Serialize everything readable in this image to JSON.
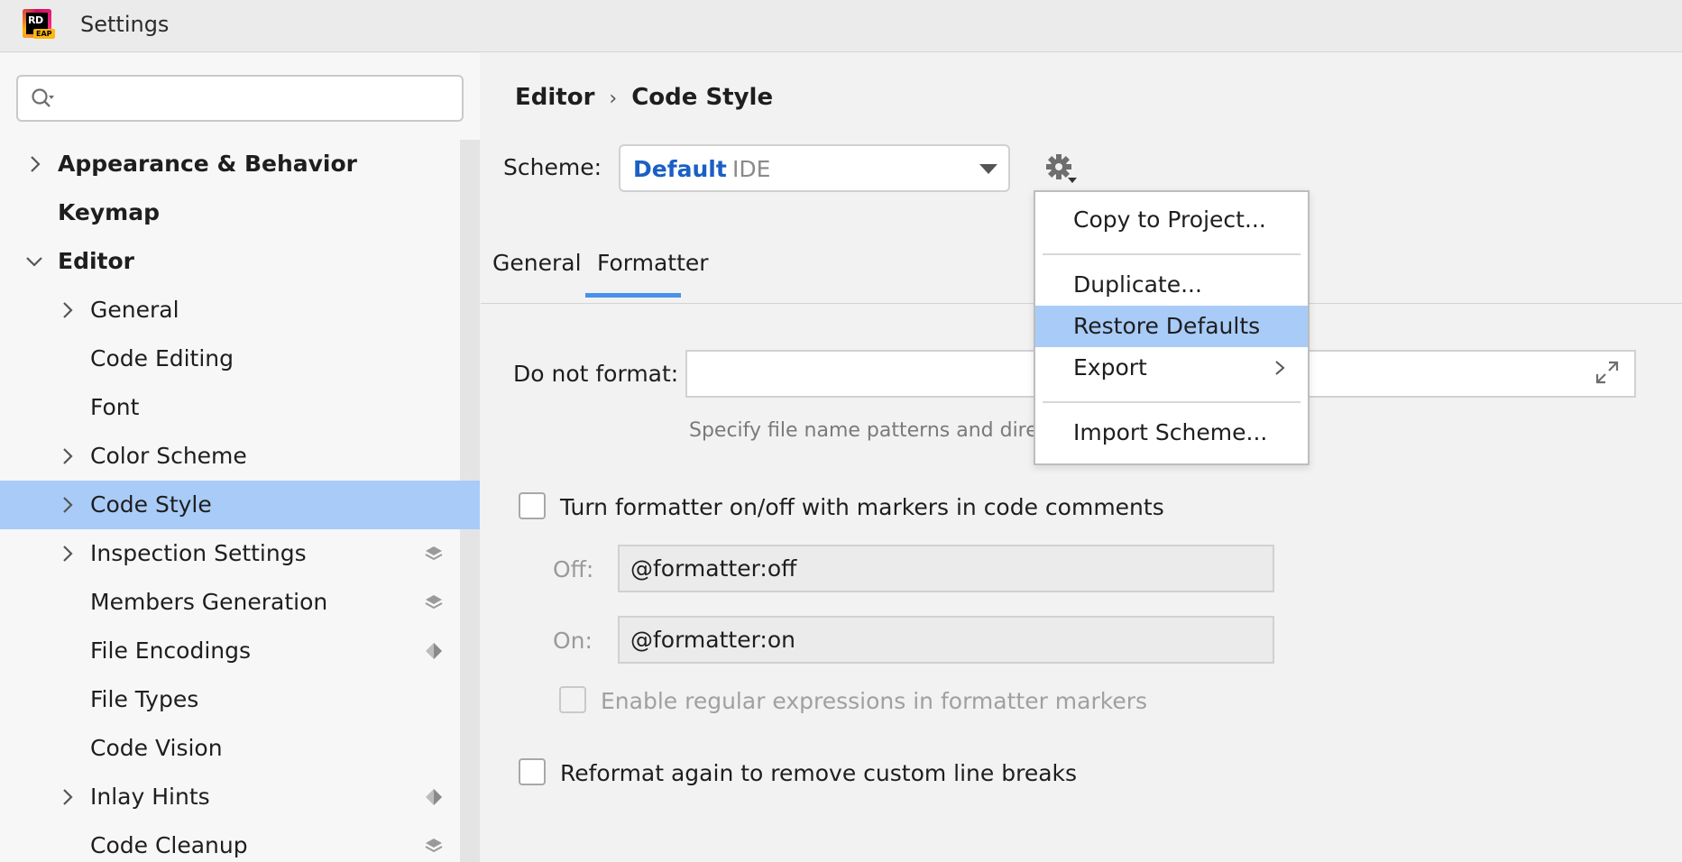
{
  "window": {
    "title": "Settings",
    "logo_text": "RD",
    "logo_badge": "EAP"
  },
  "search": {
    "placeholder": "",
    "value": ""
  },
  "sidebar": {
    "items": [
      {
        "label": "Appearance & Behavior"
      },
      {
        "label": "Keymap"
      },
      {
        "label": "Editor"
      },
      {
        "label": "General"
      },
      {
        "label": "Code Editing"
      },
      {
        "label": "Font"
      },
      {
        "label": "Color Scheme"
      },
      {
        "label": "Code Style"
      },
      {
        "label": "Inspection Settings"
      },
      {
        "label": "Members Generation"
      },
      {
        "label": "File Encodings"
      },
      {
        "label": "File Types"
      },
      {
        "label": "Code Vision"
      },
      {
        "label": "Inlay Hints"
      },
      {
        "label": "Code Cleanup"
      }
    ]
  },
  "breadcrumb": {
    "parent": "Editor",
    "current": "Code Style"
  },
  "scheme": {
    "label": "Scheme:",
    "name": "Default",
    "kind": "IDE"
  },
  "tabs": [
    {
      "label": "General"
    },
    {
      "label": "Formatter"
    }
  ],
  "formatter": {
    "do_not_format_label": "Do not format:",
    "do_not_format_value": "",
    "hint": "Specify file name patterns and direc",
    "markers_checkbox": "Turn formatter on/off with markers in code comments",
    "off_label": "Off:",
    "off_value": "@formatter:off",
    "on_label": "On:",
    "on_value": "@formatter:on",
    "regex_checkbox": "Enable regular expressions in formatter markers",
    "reformat_checkbox": "Reformat again to remove custom line breaks"
  },
  "popup": {
    "copy": "Copy to Project...",
    "duplicate": "Duplicate...",
    "restore": "Restore Defaults",
    "export": "Export",
    "import": "Import Scheme..."
  },
  "colors": {
    "accent": "#1a5fc4",
    "selection": "#a9cbf8",
    "tab_underline": "#4a90e8"
  }
}
